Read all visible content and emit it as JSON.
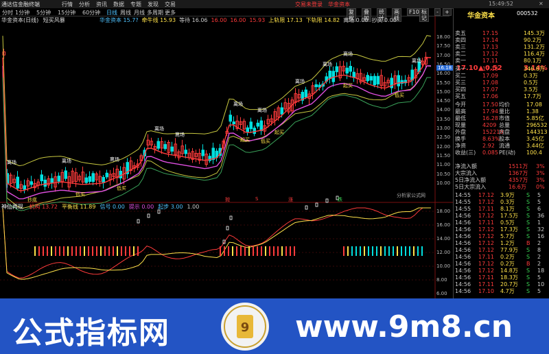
{
  "menubar": {
    "app_name": "通达信金融终端",
    "items": [
      "行情",
      "分析",
      "资讯",
      "数据",
      "专题",
      "发现",
      "交易"
    ],
    "login_label": "交易未登录",
    "stock_label": "华金资本",
    "time": "15:49:52",
    "window_controls": [
      "关闭"
    ]
  },
  "tabbar": {
    "tabs": [
      "分时",
      "1分钟",
      "5分钟",
      "15分钟",
      "60分钟",
      "日线",
      "周线",
      "月线",
      "多周期",
      "更多"
    ],
    "active": "日线",
    "right_buttons": [
      "复权",
      "叠加",
      "统计",
      "画线",
      "F10",
      "标记",
      "-",
      "+"
    ]
  },
  "main_chart": {
    "header": "华金资本(日线)",
    "indicator": "短买风暴",
    "legend": [
      {
        "label": "华金资本",
        "value": "15.7?",
        "color": "#4fc3ff"
      },
      {
        "label": "牵牛线",
        "value": "15.93",
        "color": "#ffe24a"
      },
      {
        "label": "等待",
        "value": "16.06",
        "color": "#ccc"
      },
      {
        "label": "",
        "value": "16.00",
        "color": "#ff3b3b"
      },
      {
        "label": "",
        "value": "16.00",
        "color": "#ff3b3b"
      },
      {
        "label": "",
        "value": "15.93",
        "color": "#ff3b3b"
      },
      {
        "label": "上轨限",
        "value": "17.13",
        "color": "#ffe24a"
      },
      {
        "label": "下轨限",
        "value": "14.82",
        "color": "#ffe24a"
      },
      {
        "label": "离场",
        "value": "0.00",
        "color": "#ccc"
      },
      {
        "label": "抄买",
        "value": "0.00",
        "color": "#ccc"
      }
    ],
    "price_labels": [
      "18.00",
      "17.50",
      "17.00",
      "16.50",
      "16.00",
      "15.50",
      "15.00",
      "14.50",
      "14.00",
      "13.50",
      "13.00",
      "12.50",
      "12.00",
      "11.50",
      "11.00",
      "10.50",
      "10.00"
    ],
    "current_price_tag": "16.18",
    "signal_tags": [
      "离场",
      "离场",
      "离场",
      "离场",
      "离场",
      "离场",
      "离场",
      "离场",
      "离场",
      "离场"
    ],
    "buy_tags": [
      "抄底",
      "低买",
      "低买",
      "起买",
      "低买",
      "起买",
      "起买",
      "低买"
    ],
    "bottom_labels": [
      "抛",
      "S",
      "涨",
      "跌",
      "分析家公式网"
    ]
  },
  "sub_chart": {
    "indicator": "神仙再现",
    "legend": [
      {
        "label": "机构",
        "value": "13.72",
        "color": "#ff3b3b"
      },
      {
        "label": "平衡线",
        "value": "11.89",
        "color": "#ffe24a"
      },
      {
        "label": "信号",
        "value": "0.00",
        "color": "#4fc3ff"
      },
      {
        "label": "提示",
        "value": "0.00",
        "color": "#e04fe0"
      },
      {
        "label": "起步",
        "value": "3.00",
        "color": "#4fc3ff"
      },
      {
        "label": "",
        "value": "1.00",
        "color": "#ccc"
      }
    ],
    "axis_labels": [
      "18.00",
      "16.00",
      "14.00",
      "12.00",
      "10.00",
      "8.00",
      "6.00"
    ]
  },
  "quote": {
    "name": "华金资本",
    "code": "000532",
    "price": "17.10",
    "change": "0.52",
    "pct": "3.14%",
    "asks": [
      {
        "label": "卖五",
        "price": "17.15",
        "vol": "145.3万"
      },
      {
        "label": "卖四",
        "price": "17.14",
        "vol": "90.2万"
      },
      {
        "label": "卖三",
        "price": "17.13",
        "vol": "131.2万"
      },
      {
        "label": "卖二",
        "price": "17.12",
        "vol": "116.4万"
      },
      {
        "label": "卖一",
        "price": "17.11",
        "vol": "80.1万"
      }
    ],
    "bids": [
      {
        "label": "买一",
        "price": "17.10",
        "vol": "346.8万"
      },
      {
        "label": "买二",
        "price": "17.09",
        "vol": "0.3万"
      },
      {
        "label": "买三",
        "price": "17.08",
        "vol": "0.5万"
      },
      {
        "label": "买四",
        "price": "17.07",
        "vol": "3.5万"
      },
      {
        "label": "买五",
        "price": "17.06",
        "vol": "17.7万"
      }
    ],
    "stats": [
      [
        "今开",
        "17.50",
        "均价",
        "17.08"
      ],
      [
        "最高",
        "17.94",
        "量比",
        "1.38"
      ],
      [
        "最低",
        "16.28",
        "市值",
        "5.85亿"
      ],
      [
        "现量",
        "4209",
        "总量",
        "296532"
      ],
      [
        "外盘",
        "152219",
        "内盘",
        "144313"
      ],
      [
        "换手",
        "8.63%",
        "股本",
        "3.45亿"
      ],
      [
        "净资",
        "2.92",
        "流通",
        "3.44亿"
      ],
      [
        "收益(三)",
        "0.085",
        "PE(动)",
        "100.4"
      ]
    ],
    "flows": [
      {
        "label": "净流入额",
        "value": "1511万",
        "pct": "3%"
      },
      {
        "label": "大宗流入",
        "value": "1367万",
        "pct": "3%"
      },
      {
        "label": "5日净流入额",
        "value": "4357万",
        "pct": "3%"
      },
      {
        "label": "5日大宗流入",
        "value": "16.6万",
        "pct": "0%"
      }
    ],
    "ticks": [
      [
        "14:55",
        "17.12",
        "3.9万",
        "S",
        "5"
      ],
      [
        "14:55",
        "17.12",
        "0.3万",
        "S",
        "5"
      ],
      [
        "14:55",
        "17.11",
        "8.1万",
        "S",
        "6"
      ],
      [
        "14:56",
        "17.12",
        "17.5万",
        "S",
        "36"
      ],
      [
        "14:56",
        "17.11",
        "0.5万",
        "S",
        "1"
      ],
      [
        "14:56",
        "17.12",
        "17.3万",
        "S",
        "32"
      ],
      [
        "14:56",
        "17.12",
        "5.7万",
        "S",
        "16"
      ],
      [
        "14:56",
        "17.12",
        "1.2万",
        "B",
        "2"
      ],
      [
        "14:56",
        "17.12",
        "77.9万",
        "S",
        "8"
      ],
      [
        "14:56",
        "17.11",
        "0.2万",
        "S",
        "2"
      ],
      [
        "14:56",
        "17.12",
        "0.2万",
        "B",
        "2"
      ],
      [
        "14:56",
        "17.12",
        "14.8万",
        "S",
        "18"
      ],
      [
        "14:56",
        "17.11",
        "18.3万",
        "S",
        "5"
      ],
      [
        "14:56",
        "17.11",
        "20.7万",
        "S",
        "10"
      ],
      [
        "14:56",
        "17.10",
        "4.7万",
        "S",
        "5"
      ]
    ]
  },
  "banner": {
    "title": "公式指标网",
    "url": "www.9m8.cn",
    "seal_text": "www.9m8.cn"
  },
  "colors": {
    "up": "#ff3b3b",
    "down": "#39d353",
    "cyan": "#4fc3ff",
    "yellow": "#ffe24a",
    "banner": "#2354c4"
  }
}
